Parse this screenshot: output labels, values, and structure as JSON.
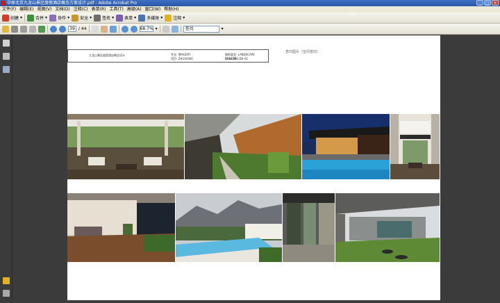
{
  "window": {
    "title": "中原北京九龙山景区度假酒店概念方案设计.pdf - Adobe Acrobat Pro",
    "buttons": [
      "_",
      "□",
      "×"
    ]
  },
  "menu": [
    "文件(F)",
    "编辑(E)",
    "视图(V)",
    "文档(D)",
    "注释(C)",
    "表单(R)",
    "工具(T)",
    "高级(A)",
    "窗口(W)",
    "帮助(H)"
  ],
  "toolbar1": {
    "create": "创建",
    "combine": "合并",
    "collaborate": "协作",
    "secure": "安全",
    "sign": "签名",
    "forms": "表单",
    "multimedia": "多媒体",
    "comment": "注释"
  },
  "toolbar2": {
    "page_current": "39",
    "page_total": "/ 44",
    "zoom": "68.7%",
    "find_placeholder": "查找"
  },
  "document": {
    "header_title": "九龙山景区度假酒店概念设计",
    "col2_line1": "专业: IMAGERY",
    "col2_line2": "项目: ZHUXIANG",
    "col3_line1": "图纸类型: LANDSCAPE BUILDING",
    "col3_line2": "2016.09 · DH-02",
    "page_label": "意向图片（空间意向）"
  },
  "colors": {
    "titlebar": "#2a58a8",
    "chrome": "#ece9d8",
    "workspace": "#3b3b3b",
    "page": "#ffffff"
  }
}
